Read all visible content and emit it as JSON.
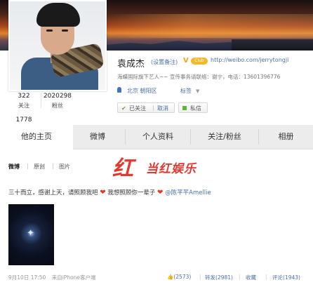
{
  "profile": {
    "name": "袁成杰",
    "name_tag": "(设置备注)",
    "v_badge": "V",
    "club_badge": "Club",
    "url": "http://weibo.com/jerrytongji",
    "intro": "海蝶国际旗下艺人~~ 宣传事务请联络：谢宁，电话：13601396776",
    "location": "北京 朝阳区",
    "tag_button": "标签"
  },
  "stats": [
    {
      "num": "322",
      "label": "关注"
    },
    {
      "num": "2020298",
      "label": "粉丝"
    },
    {
      "num": "1778",
      "label": ""
    }
  ],
  "buttons": {
    "followed": "已关注",
    "unfollow": "取消",
    "message": "私信"
  },
  "tabs": [
    "他的主页",
    "微博",
    "个人资料",
    "关注/粉丝",
    "相册"
  ],
  "subnav": [
    "微博",
    "原创",
    "图片"
  ],
  "watermark": {
    "logo": "红",
    "text": "当红娱乐"
  },
  "post": {
    "text1": "三十而立，感谢上天，请照顾我吧",
    "text2": "我想照顾你一辈子",
    "mention": "@陈芊芊Amellie",
    "date": "9月10日 17:50",
    "source": "来自iPhone客户端",
    "like": "(2573)",
    "repost": "转发(2981)",
    "favorite": "收藏",
    "comment": "评论(1943)"
  },
  "colors": {
    "link": "#4b71a8",
    "heart": "#e23b2b",
    "watermark": "#e2382f"
  }
}
